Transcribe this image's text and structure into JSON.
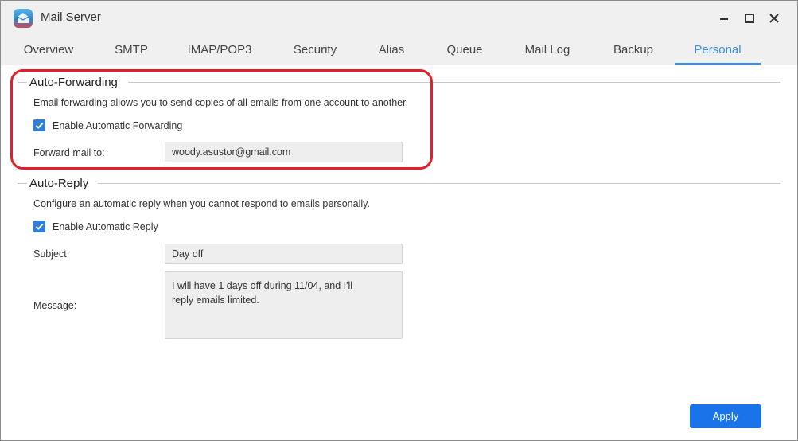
{
  "window": {
    "title": "Mail Server"
  },
  "tabs": [
    {
      "label": "Overview",
      "active": false
    },
    {
      "label": "SMTP",
      "active": false
    },
    {
      "label": "IMAP/POP3",
      "active": false
    },
    {
      "label": "Security",
      "active": false
    },
    {
      "label": "Alias",
      "active": false
    },
    {
      "label": "Queue",
      "active": false
    },
    {
      "label": "Mail Log",
      "active": false
    },
    {
      "label": "Backup",
      "active": false
    },
    {
      "label": "Personal",
      "active": true
    }
  ],
  "auto_forwarding": {
    "title": "Auto-Forwarding",
    "description": "Email forwarding allows you to send copies of all emails from one account to another.",
    "enable_label": "Enable Automatic Forwarding",
    "enabled": true,
    "forward_label": "Forward mail to:",
    "forward_value": "woody.asustor@gmail.com"
  },
  "auto_reply": {
    "title": "Auto-Reply",
    "description": "Configure an automatic reply when you cannot respond to emails personally.",
    "enable_label": "Enable Automatic Reply",
    "enabled": true,
    "subject_label": "Subject:",
    "subject_value": "Day off",
    "message_label": "Message:",
    "message_value": "I will have 1 days off during 11/04, and I'll\nreply emails limited."
  },
  "footer": {
    "apply_label": "Apply"
  },
  "colors": {
    "accent": "#3b8fe0",
    "apply_button": "#1a73e8",
    "highlight": "#e3202a"
  }
}
